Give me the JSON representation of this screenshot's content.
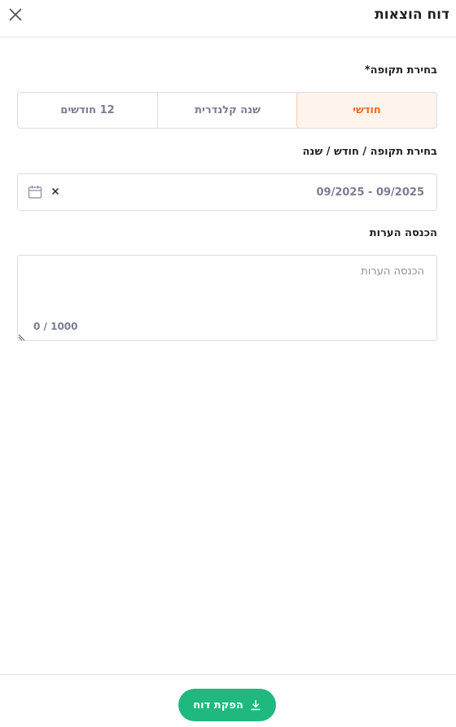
{
  "header": {
    "title": "דוח הוצאות",
    "close_icon": "close-icon"
  },
  "period": {
    "label": "בחירת תקופה*",
    "options": [
      {
        "label": "חודשי",
        "active": true
      },
      {
        "label": "שנה קלנדרית",
        "active": false
      },
      {
        "label": "12 חודשים",
        "active": false
      }
    ]
  },
  "date_range": {
    "label": "בחירת תקופה / חודש / שנה",
    "value": "09/2025 - 09/2025",
    "calendar_icon": "calendar-icon",
    "clear_icon": "clear-icon"
  },
  "notes": {
    "label": "הכנסה הערות",
    "placeholder": "הכנסה הערות",
    "counter": "0 / 1000"
  },
  "footer": {
    "button_label": "הפקת דוח",
    "button_icon": "download-icon"
  },
  "colors": {
    "accent": "#f06a1f",
    "active_bg": "#fff4ec",
    "primary_button": "#1fb97f",
    "muted_text": "#7a7d92"
  }
}
